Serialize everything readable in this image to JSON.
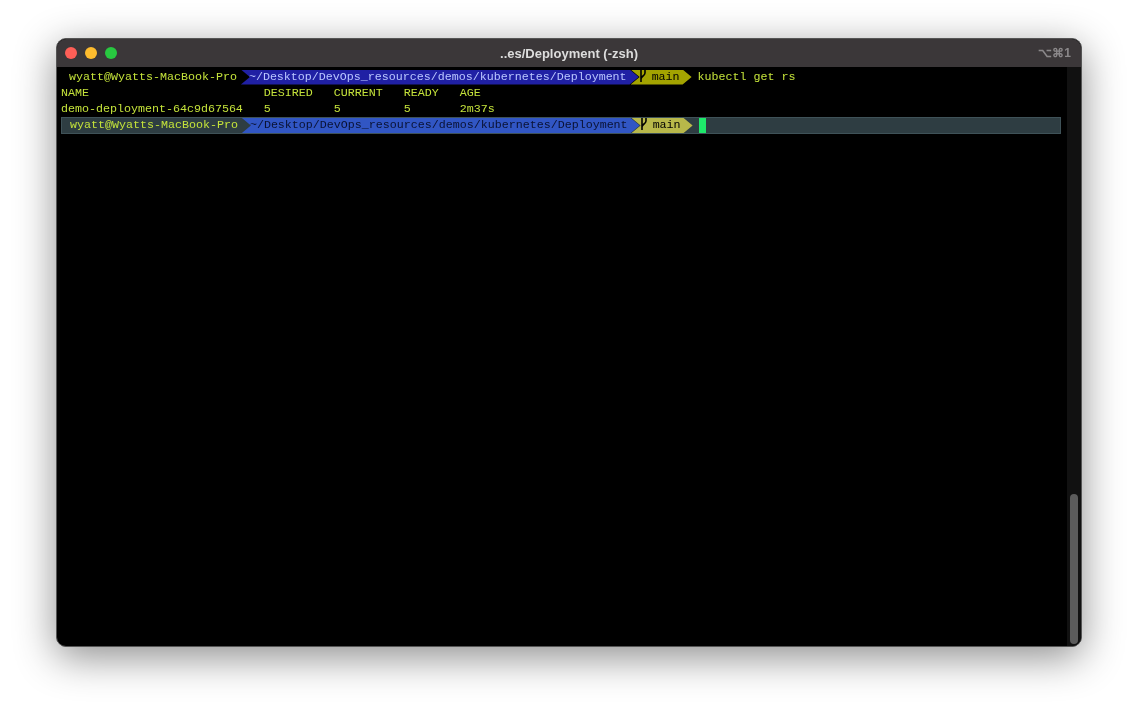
{
  "window": {
    "title": "..es/Deployment (-zsh)",
    "shortcut": "⌥⌘1"
  },
  "prompts": [
    {
      "current": false,
      "user": "wyatt@Wyatts-MacBook-Pro",
      "path": "~/Desktop/DevOps_resources/demos/kubernetes/Deployment",
      "branch": "main",
      "command": "kubectl get rs"
    },
    {
      "current": true,
      "user": "wyatt@Wyatts-MacBook-Pro",
      "path": "~/Desktop/DevOps_resources/demos/kubernetes/Deployment",
      "branch": "main"
    }
  ],
  "output": {
    "columns": [
      "NAME",
      "DESIRED",
      "CURRENT",
      "READY",
      "AGE"
    ],
    "rows": [
      [
        "demo-deployment-64c9d67564",
        "5",
        "5",
        "5",
        "2m37s"
      ]
    ]
  }
}
